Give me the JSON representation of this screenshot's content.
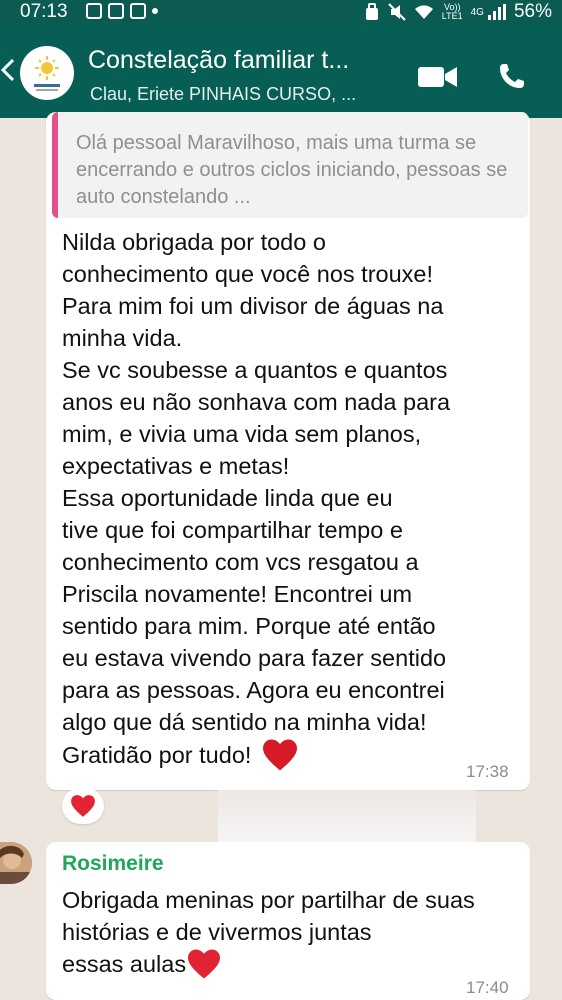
{
  "status_bar": {
    "time": "07:13",
    "volte_top": "Vo))",
    "volte_bottom": "LTE1",
    "network": "4G",
    "battery": "56%"
  },
  "header": {
    "title": "Constelação familiar t...",
    "subtitle": "Clau, Eriete PINHAIS CURSO, ...",
    "icons": [
      "back-arrow-icon",
      "group-avatar",
      "video-call-icon",
      "voice-call-icon"
    ],
    "accent_color": "#075e54"
  },
  "messages": [
    {
      "quote": "Olá pessoal Maravilhoso, mais uma turma se encerrando e outros ciclos iniciando, pessoas se auto constelando ...",
      "text": "Nilda obrigada por todo o\nconhecimento que você nos trouxe!\nPara mim foi um divisor de águas na\nminha vida.\nSe vc soubesse a quantos e quantos\nanos eu não sonhava com nada para\nmim, e vivia uma vida sem planos,\nexpectativas e metas!\nEssa oportunidade linda que eu\ntive que foi compartilhar tempo e\nconhecimento com vcs resgatou a\nPriscila novamente! Encontrei um\nsentido para mim. Porque até então\neu estava vivendo para fazer sentido\npara as pessoas. Agora eu encontrei\nalgo que dá sentido na minha vida!",
      "last_line": "Gratidão por tudo!",
      "time": "17:38",
      "reaction": "heart"
    },
    {
      "sender": "Rosimeire",
      "sender_color": "#1fa855",
      "text": "Obrigada meninas por partilhar de suas histórias e de vivermos juntas",
      "last_word": "essas aulas",
      "time": "17:40"
    }
  ]
}
